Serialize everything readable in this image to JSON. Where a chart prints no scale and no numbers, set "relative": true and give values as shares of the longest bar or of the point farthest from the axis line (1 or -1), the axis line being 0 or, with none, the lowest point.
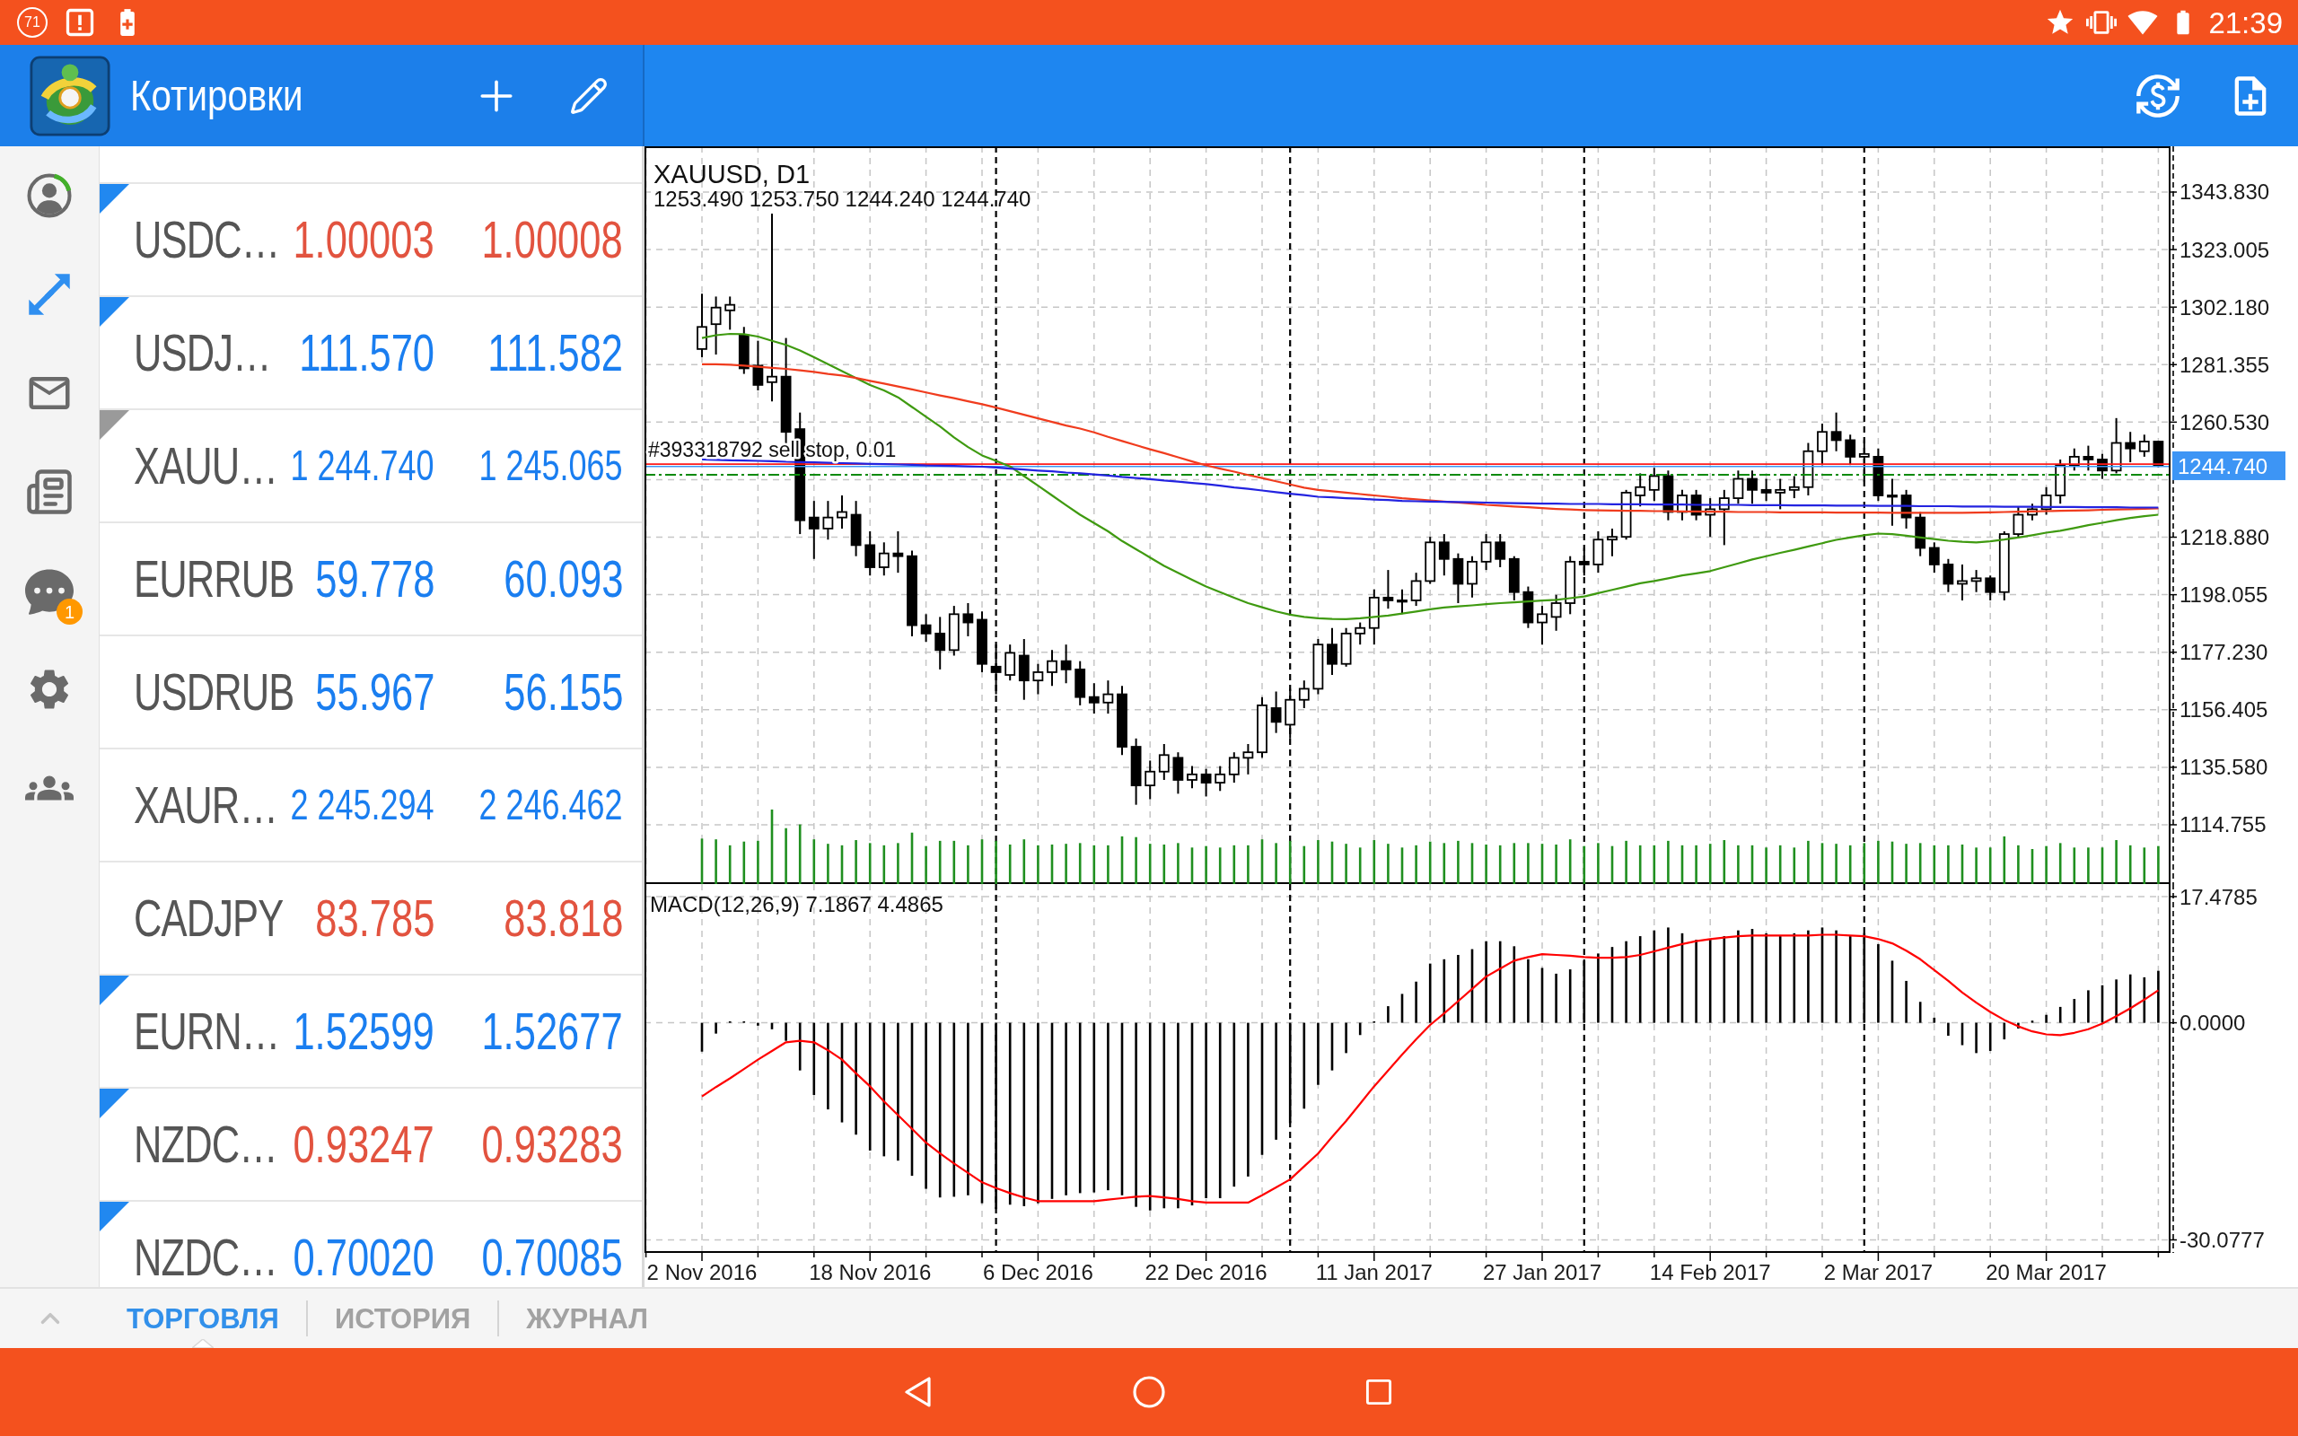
{
  "status_bar": {
    "notification_count": "71",
    "time": "21:39"
  },
  "app_bar": {
    "title": "Котировки"
  },
  "nav_items": [
    {
      "selected": false
    },
    {
      "selected": true
    },
    {
      "selected": false
    },
    {
      "selected": false
    },
    {
      "selected": false,
      "badge": "1"
    },
    {
      "selected": false
    },
    {
      "selected": false
    }
  ],
  "quotes": [
    {
      "symbol": "USDC…",
      "bid": "1.00003",
      "ask": "1.00008",
      "color": "#e2533f",
      "flag": {
        "color": "#2188f0"
      }
    },
    {
      "symbol": "USDJ…",
      "bid": "111.570",
      "ask": "111.582",
      "color": "#1a7ef0",
      "flag": {
        "color": "#2188f0"
      }
    },
    {
      "symbol": "XAUU…",
      "bid": "1 244.740",
      "ask": "1 245.065",
      "color": "#1a7ef0",
      "flag": {
        "color": "#9a9a9a"
      }
    },
    {
      "symbol": "EURRUB",
      "bid": "59.778",
      "ask": "60.093",
      "color": "#1a7ef0"
    },
    {
      "symbol": "USDRUB",
      "bid": "55.967",
      "ask": "56.155",
      "color": "#1a7ef0"
    },
    {
      "symbol": "XAUR…",
      "bid": "2 245.294",
      "ask": "2 246.462",
      "color": "#1a7ef0"
    },
    {
      "symbol": "CADJPY",
      "bid": "83.785",
      "ask": "83.818",
      "color": "#e2533f"
    },
    {
      "symbol": "EURN…",
      "bid": "1.52599",
      "ask": "1.52677",
      "color": "#1a7ef0",
      "flag": {
        "color": "#2188f0"
      }
    },
    {
      "symbol": "NZDC…",
      "bid": "0.93247",
      "ask": "0.93283",
      "color": "#e2533f",
      "flag": {
        "color": "#2188f0"
      }
    },
    {
      "symbol": "NZDC…",
      "bid": "0.70020",
      "ask": "0.70085",
      "color": "#1a7ef0",
      "flag": {
        "color": "#2188f0"
      }
    }
  ],
  "chart": {
    "chart_data": [
      {
        "type": "candlestick",
        "title": "XAUUSD, D1",
        "subtitle": "1253.490 1253.750 1244.240 1244.740",
        "tick_labels": "y",
        "grid": true,
        "ylim": [
          1093.3,
          1360.4
        ],
        "yticks": [
          {
            "value": 1343.83,
            "label": "1343.830"
          },
          {
            "value": 1323.005,
            "label": "1323.005"
          },
          {
            "value": 1302.18,
            "label": "1302.180"
          },
          {
            "value": 1281.355,
            "label": "1281.355"
          },
          {
            "value": 1260.53,
            "label": "1260.530"
          },
          {
            "value": 1218.88,
            "label": "1218.880"
          },
          {
            "value": 1198.055,
            "label": "1198.055"
          },
          {
            "value": 1177.23,
            "label": "1177.230"
          },
          {
            "value": 1156.405,
            "label": "1156.405"
          },
          {
            "value": 1135.58,
            "label": "1135.580"
          },
          {
            "value": 1114.755,
            "label": "1114.755"
          }
        ],
        "ohlc": [
          [
            1287,
            1307,
            1284,
            1295
          ],
          [
            1296,
            1306,
            1285,
            1302
          ],
          [
            1301,
            1306,
            1294,
            1303
          ],
          [
            1292,
            1295,
            1278,
            1280
          ],
          [
            1281,
            1290,
            1272,
            1274
          ],
          [
            1275,
            1336,
            1268,
            1277
          ],
          [
            1277,
            1291,
            1252,
            1257
          ],
          [
            1258,
            1264,
            1220,
            1225
          ],
          [
            1226,
            1232,
            1211,
            1222
          ],
          [
            1222,
            1232,
            1218,
            1226
          ],
          [
            1226,
            1234,
            1222,
            1228
          ],
          [
            1227,
            1232,
            1212,
            1216
          ],
          [
            1216,
            1221,
            1205,
            1208
          ],
          [
            1208,
            1217,
            1205,
            1213
          ],
          [
            1213,
            1221,
            1206,
            1212
          ],
          [
            1212,
            1214,
            1183,
            1187
          ],
          [
            1187,
            1191,
            1181,
            1184
          ],
          [
            1184,
            1190,
            1171,
            1178
          ],
          [
            1178,
            1194,
            1176,
            1191
          ],
          [
            1191,
            1195,
            1183,
            1188
          ],
          [
            1189,
            1192,
            1170,
            1173
          ],
          [
            1172,
            1180,
            1162,
            1170
          ],
          [
            1169,
            1180,
            1167,
            1177
          ],
          [
            1176,
            1182,
            1160,
            1167
          ],
          [
            1167,
            1173,
            1162,
            1170
          ],
          [
            1170,
            1178,
            1165,
            1174
          ],
          [
            1174,
            1180,
            1166,
            1171
          ],
          [
            1171,
            1174,
            1158,
            1161
          ],
          [
            1161,
            1166,
            1155,
            1159
          ],
          [
            1159,
            1167,
            1155,
            1162
          ],
          [
            1162,
            1165,
            1140,
            1143
          ],
          [
            1143,
            1146,
            1122,
            1129
          ],
          [
            1129,
            1138,
            1124,
            1134
          ],
          [
            1134,
            1144,
            1131,
            1140
          ],
          [
            1139,
            1141,
            1126,
            1131
          ],
          [
            1131,
            1136,
            1128,
            1133
          ],
          [
            1133,
            1135,
            1125,
            1130
          ],
          [
            1130,
            1136,
            1127,
            1133
          ],
          [
            1133,
            1141,
            1130,
            1139
          ],
          [
            1139,
            1144,
            1133,
            1141
          ],
          [
            1141,
            1161,
            1139,
            1158
          ],
          [
            1157,
            1163,
            1148,
            1152
          ],
          [
            1151,
            1164,
            1146,
            1160
          ],
          [
            1160,
            1167,
            1157,
            1164
          ],
          [
            1164,
            1182,
            1162,
            1180
          ],
          [
            1180,
            1186,
            1169,
            1173
          ],
          [
            1173,
            1186,
            1172,
            1184
          ],
          [
            1184,
            1188,
            1180,
            1186
          ],
          [
            1186,
            1200,
            1180,
            1197
          ],
          [
            1197,
            1207,
            1193,
            1196
          ],
          [
            1196,
            1200,
            1191,
            1196
          ],
          [
            1196,
            1206,
            1194,
            1203
          ],
          [
            1203,
            1219,
            1202,
            1217
          ],
          [
            1217,
            1220,
            1205,
            1211
          ],
          [
            1211,
            1213,
            1195,
            1202
          ],
          [
            1202,
            1212,
            1197,
            1210
          ],
          [
            1210,
            1220,
            1207,
            1217
          ],
          [
            1217,
            1220,
            1208,
            1211
          ],
          [
            1211,
            1212,
            1196,
            1199
          ],
          [
            1199,
            1201,
            1186,
            1188
          ],
          [
            1188,
            1194,
            1180,
            1191
          ],
          [
            1190,
            1198,
            1185,
            1195
          ],
          [
            1195,
            1212,
            1191,
            1210
          ],
          [
            1210,
            1215,
            1205,
            1209
          ],
          [
            1209,
            1221,
            1206,
            1218
          ],
          [
            1218,
            1222,
            1212,
            1219
          ],
          [
            1219,
            1236,
            1218,
            1235
          ],
          [
            1234,
            1242,
            1230,
            1237
          ],
          [
            1236,
            1244,
            1232,
            1241
          ],
          [
            1241,
            1243,
            1225,
            1228
          ],
          [
            1228,
            1236,
            1225,
            1234
          ],
          [
            1234,
            1236,
            1225,
            1227
          ],
          [
            1227,
            1233,
            1219,
            1229
          ],
          [
            1229,
            1236,
            1216,
            1233
          ],
          [
            1233,
            1243,
            1231,
            1240
          ],
          [
            1240,
            1243,
            1231,
            1236
          ],
          [
            1236,
            1240,
            1232,
            1235
          ],
          [
            1235,
            1240,
            1229,
            1236
          ],
          [
            1236,
            1241,
            1233,
            1237
          ],
          [
            1237,
            1253,
            1234,
            1250
          ],
          [
            1250,
            1260,
            1245,
            1257
          ],
          [
            1257,
            1264,
            1250,
            1254
          ],
          [
            1254,
            1256,
            1245,
            1248
          ],
          [
            1248,
            1254,
            1239,
            1249
          ],
          [
            1248,
            1251,
            1232,
            1234
          ],
          [
            1234,
            1240,
            1223,
            1234
          ],
          [
            1234,
            1236,
            1222,
            1226
          ],
          [
            1226,
            1228,
            1212,
            1215
          ],
          [
            1215,
            1217,
            1206,
            1209
          ],
          [
            1209,
            1211,
            1199,
            1202
          ],
          [
            1202,
            1209,
            1196,
            1203
          ],
          [
            1203,
            1207,
            1199,
            1204
          ],
          [
            1204,
            1205,
            1196,
            1199
          ],
          [
            1199,
            1221,
            1196,
            1220
          ],
          [
            1220,
            1230,
            1219,
            1227
          ],
          [
            1227,
            1231,
            1225,
            1229
          ],
          [
            1229,
            1237,
            1227,
            1234
          ],
          [
            1234,
            1247,
            1231,
            1245
          ],
          [
            1245,
            1251,
            1243,
            1248
          ],
          [
            1248,
            1252,
            1243,
            1247
          ],
          [
            1247,
            1249,
            1240,
            1243
          ],
          [
            1243,
            1262,
            1242,
            1253
          ],
          [
            1253,
            1257,
            1246,
            1251
          ],
          [
            1250,
            1256,
            1248,
            1253.5
          ],
          [
            1253.49,
            1253.75,
            1244.24,
            1244.74
          ]
        ],
        "series": [
          {
            "type": "line",
            "color": "#3f9a10",
            "values": [
              1291,
              1292,
              1292.5,
              1292.4,
              1291.5,
              1290,
              1288.5,
              1286.5,
              1284,
              1281.5,
              1279,
              1276.5,
              1274,
              1272,
              1269.5,
              1266,
              1262.5,
              1259,
              1255,
              1251.5,
              1248.5,
              1246.5,
              1244.5,
              1241,
              1237.5,
              1234,
              1230.5,
              1227,
              1224,
              1221,
              1217.5,
              1214.5,
              1211.5,
              1208.5,
              1206,
              1203.5,
              1201,
              1199,
              1197,
              1195,
              1193.5,
              1192,
              1190.8,
              1190,
              1189.5,
              1189.3,
              1189.2,
              1189.5,
              1190,
              1190.5,
              1191.2,
              1192,
              1192.8,
              1193.4,
              1193.8,
              1194.2,
              1194.6,
              1195,
              1195.3,
              1195.6,
              1195.9,
              1196.2,
              1196.8,
              1197.4,
              1198.6,
              1199.8,
              1201,
              1202.2,
              1203,
              1204,
              1205,
              1205.8,
              1206.6,
              1208,
              1209.4,
              1210.8,
              1212,
              1213.2,
              1214.3,
              1215.5,
              1216.7,
              1217.9,
              1218.8,
              1219.6,
              1220.2,
              1220,
              1219.4,
              1218.8,
              1218.2,
              1217.6,
              1217.2,
              1217,
              1217.4,
              1218,
              1218.8,
              1219.6,
              1220.5,
              1221.2,
              1222.2,
              1223.2,
              1224.1,
              1225,
              1225.8,
              1226.5,
              1227
            ]
          },
          {
            "type": "line",
            "color": "#f03c1e",
            "values": [
              1281.5,
              1281.5,
              1281.3,
              1281,
              1280.6,
              1280.2,
              1279.8,
              1279.3,
              1278.7,
              1278,
              1277.4,
              1276.5,
              1275.5,
              1274.5,
              1273.4,
              1272.4,
              1271.3,
              1270.2,
              1269.2,
              1268.1,
              1267,
              1265.8,
              1264.5,
              1263.2,
              1261.9,
              1260.6,
              1259.3,
              1258.2,
              1256.8,
              1255.2,
              1253.7,
              1252.2,
              1250.7,
              1249.3,
              1247.8,
              1246.3,
              1244.9,
              1243.7,
              1242.6,
              1241.4,
              1240.3,
              1239.1,
              1238,
              1236.8,
              1236,
              1235.5,
              1235,
              1234.5,
              1234,
              1233.5,
              1233,
              1232.6,
              1232.2,
              1231.8,
              1231.4,
              1231,
              1230.6,
              1230.3,
              1230,
              1229.7,
              1229.4,
              1229.1,
              1228.9,
              1228.7,
              1228.6,
              1228.5,
              1228.4,
              1228.4,
              1228.3,
              1228.3,
              1228.2,
              1228.2,
              1228.1,
              1228.1,
              1228,
              1228,
              1228,
              1227.9,
              1227.9,
              1227.9,
              1227.9,
              1227.8,
              1227.8,
              1227.8,
              1227.8,
              1227.7,
              1227.7,
              1227.7,
              1227.7,
              1227.7,
              1227.7,
              1227.8,
              1227.9,
              1228,
              1228.1,
              1228.2,
              1228.3,
              1228.4,
              1228.5,
              1228.6,
              1228.8,
              1228.9,
              1229,
              1229.2,
              1229.3
            ]
          },
          {
            "type": "line",
            "color": "#2323e0",
            "values": [
              1247,
              1246.9,
              1246.7,
              1246.6,
              1246.5,
              1246.4,
              1246.2,
              1246.1,
              1246,
              1245.8,
              1245.7,
              1245.6,
              1245.4,
              1245.3,
              1245.2,
              1245.1,
              1244.9,
              1244.8,
              1244.7,
              1244.5,
              1244.4,
              1244.1,
              1243.7,
              1243.4,
              1243,
              1242.7,
              1242.3,
              1242,
              1241.6,
              1241.2,
              1240.7,
              1240.3,
              1239.9,
              1239.4,
              1239,
              1238.5,
              1238.1,
              1237.5,
              1236.9,
              1236.4,
              1235.8,
              1235.2,
              1234.6,
              1234.1,
              1233.5,
              1233.3,
              1233,
              1232.8,
              1232.5,
              1232.3,
              1232,
              1231.9,
              1231.8,
              1231.7,
              1231.6,
              1231.5,
              1231.4,
              1231.3,
              1231.2,
              1231.1,
              1231,
              1231,
              1230.9,
              1230.9,
              1230.9,
              1230.8,
              1230.8,
              1230.8,
              1230.7,
              1230.7,
              1230.7,
              1230.6,
              1230.6,
              1230.6,
              1230.6,
              1230.5,
              1230.5,
              1230.5,
              1230.4,
              1230.4,
              1230.4,
              1230.3,
              1230.3,
              1230.3,
              1230.2,
              1230.2,
              1230.2,
              1230.1,
              1230.1,
              1230.1,
              1230,
              1230,
              1230,
              1229.9,
              1229.9,
              1229.9,
              1229.8,
              1229.8,
              1229.8,
              1229.7,
              1229.7,
              1229.7,
              1229.6,
              1229.6,
              1229.6
            ]
          }
        ],
        "ref_lines": [
          {
            "axis": "y",
            "value": 1244.74,
            "label": "1244.740",
            "color": "#3d95f5"
          },
          {
            "axis": "y",
            "value": 1245.065,
            "color": "#ff1a1a"
          },
          {
            "axis": "y",
            "value": 1241.5,
            "label": "#393318792 sell stop, 0.01",
            "color": "#0a8a0a",
            "line_style": "dashdot"
          }
        ]
      },
      {
        "type": "bar",
        "relative": true,
        "color": "#1f8f1f",
        "values": [
          0.61,
          0.6,
          0.52,
          0.57,
          0.58,
          1,
          0.75,
          0.8,
          0.6,
          0.54,
          0.52,
          0.59,
          0.55,
          0.52,
          0.55,
          0.69,
          0.51,
          0.58,
          0.58,
          0.52,
          0.6,
          0.58,
          0.53,
          0.6,
          0.52,
          0.53,
          0.54,
          0.55,
          0.52,
          0.52,
          0.64,
          0.63,
          0.54,
          0.53,
          0.55,
          0.49,
          0.51,
          0.49,
          0.52,
          0.52,
          0.6,
          0.55,
          0.58,
          0.51,
          0.59,
          0.57,
          0.54,
          0.49,
          0.59,
          0.54,
          0.49,
          0.52,
          0.57,
          0.55,
          0.58,
          0.55,
          0.53,
          0.52,
          0.55,
          0.55,
          0.54,
          0.53,
          0.6,
          0.51,
          0.55,
          0.51,
          0.58,
          0.52,
          0.52,
          0.58,
          0.52,
          0.52,
          0.54,
          0.59,
          0.52,
          0.52,
          0.49,
          0.52,
          0.49,
          0.58,
          0.55,
          0.54,
          0.52,
          0.55,
          0.58,
          0.57,
          0.54,
          0.55,
          0.52,
          0.52,
          0.53,
          0.49,
          0.49,
          0.64,
          0.52,
          0.47,
          0.51,
          0.55,
          0.49,
          0.49,
          0.49,
          0.59,
          0.52,
          0.49,
          0.51
        ]
      },
      {
        "type": "bar",
        "title": "MACD(12,26,9) 7.1867 4.4865",
        "grid": true,
        "ylim": [
          -31.88,
          19.22
        ],
        "yticks": [
          {
            "value": 17.4785,
            "label": "17.4785"
          },
          {
            "value": 0,
            "label": "0.0000"
          },
          {
            "value": -30.0777,
            "label": "-30.0777"
          }
        ],
        "categories": [
          "2 Nov 2016",
          null,
          null,
          null,
          null,
          null,
          null,
          null,
          null,
          null,
          null,
          null,
          "18 Nov 2016",
          null,
          null,
          null,
          null,
          null,
          null,
          null,
          null,
          null,
          null,
          null,
          "6 Dec 2016",
          null,
          null,
          null,
          null,
          null,
          null,
          null,
          null,
          null,
          null,
          null,
          "22 Dec 2016",
          null,
          null,
          null,
          null,
          null,
          null,
          null,
          null,
          null,
          null,
          null,
          "11 Jan 2017",
          null,
          null,
          null,
          null,
          null,
          null,
          null,
          null,
          null,
          null,
          null,
          "27 Jan 2017",
          null,
          null,
          null,
          null,
          null,
          null,
          null,
          null,
          null,
          null,
          null,
          "14 Feb 2017",
          null,
          null,
          null,
          null,
          null,
          null,
          null,
          null,
          null,
          null,
          null,
          "2 Mar 2017",
          null,
          null,
          null,
          null,
          null,
          null,
          null,
          null,
          null,
          null,
          null,
          "20 Mar 2017",
          null,
          null,
          null,
          null,
          null,
          null,
          null,
          null
        ],
        "series": [
          {
            "type": "bar",
            "color": "#000000",
            "values": [
              -4,
              -1.5,
              0.2,
              0.2,
              -0.4,
              -0.9,
              -2.5,
              -6.6,
              -10,
              -12,
              -13.8,
              -15.5,
              -17.7,
              -18.5,
              -19.1,
              -21.2,
              -23,
              -24.2,
              -24.1,
              -23.9,
              -25,
              -25.8,
              -25.2,
              -25.4,
              -25,
              -24.4,
              -23.9,
              -23.6,
              -23.5,
              -23.2,
              -23.9,
              -25.5,
              -26,
              -25.7,
              -25.7,
              -25.3,
              -24.3,
              -24.3,
              -22.7,
              -21.3,
              -18.3,
              -16.2,
              -13.9,
              -11.9,
              -8.6,
              -6.6,
              -4.2,
              -1.7,
              0.2,
              2.3,
              4,
              5.7,
              8.2,
              8.8,
              9.4,
              10.2,
              11.3,
              11.3,
              10.6,
              8.8,
              7.6,
              6.8,
              7.4,
              8.6,
              9.6,
              10.5,
              11.3,
              12,
              12.8,
              13.2,
              12.4,
              11.5,
              11.5,
              12,
              12.8,
              13,
              12.4,
              12,
              12.4,
              12.8,
              13.2,
              12.8,
              12,
              12.4,
              10.9,
              8.6,
              5.8,
              2.9,
              0.7,
              -1.8,
              -3.1,
              -4.2,
              -3.9,
              -2.3,
              -0.8,
              0.3,
              1.1,
              2.2,
              3.3,
              4.5,
              5.2,
              6,
              6.7,
              6.3,
              7.2
            ]
          },
          {
            "type": "line",
            "color": "#ff0000",
            "values": [
              -10.2,
              -8.9,
              -7.7,
              -6.4,
              -5.1,
              -3.9,
              -2.7,
              -2.5,
              -2.7,
              -3.8,
              -5.1,
              -7,
              -8.8,
              -10.9,
              -12.8,
              -14.7,
              -16.6,
              -18.1,
              -19.5,
              -20.8,
              -22.1,
              -22.9,
              -23.6,
              -24.2,
              -24.7,
              -24.7,
              -24.7,
              -24.7,
              -24.7,
              -24.5,
              -24.3,
              -24.1,
              -24,
              -24.2,
              -24.4,
              -24.7,
              -24.9,
              -24.9,
              -24.9,
              -24.9,
              -23.9,
              -22.8,
              -21.7,
              -19.9,
              -18.1,
              -15.8,
              -13.6,
              -11.2,
              -8.8,
              -6.6,
              -4.4,
              -2.3,
              -0.3,
              1.3,
              3,
              4.7,
              6.4,
              7.5,
              8.6,
              9.1,
              9.5,
              9.4,
              9.3,
              9.1,
              9,
              9,
              9.1,
              9.4,
              9.9,
              10.4,
              10.9,
              11.3,
              11.6,
              11.8,
              12,
              12.1,
              12.1,
              12.1,
              12.1,
              12.1,
              12.2,
              12.2,
              12.1,
              12,
              11.6,
              11,
              10,
              8.8,
              7.3,
              5.8,
              4.2,
              2.8,
              1.5,
              0.4,
              -0.5,
              -1.2,
              -1.6,
              -1.7,
              -1.4,
              -0.9,
              -0.1,
              0.9,
              2,
              3.2,
              4.5
            ]
          }
        ]
      }
    ]
  },
  "tabs": [
    {
      "label": "ТОРГОВЛЯ",
      "selected": true
    },
    {
      "label": "ИСТОРИЯ",
      "selected": false
    },
    {
      "label": "ЖУРНАЛ",
      "selected": false
    }
  ]
}
